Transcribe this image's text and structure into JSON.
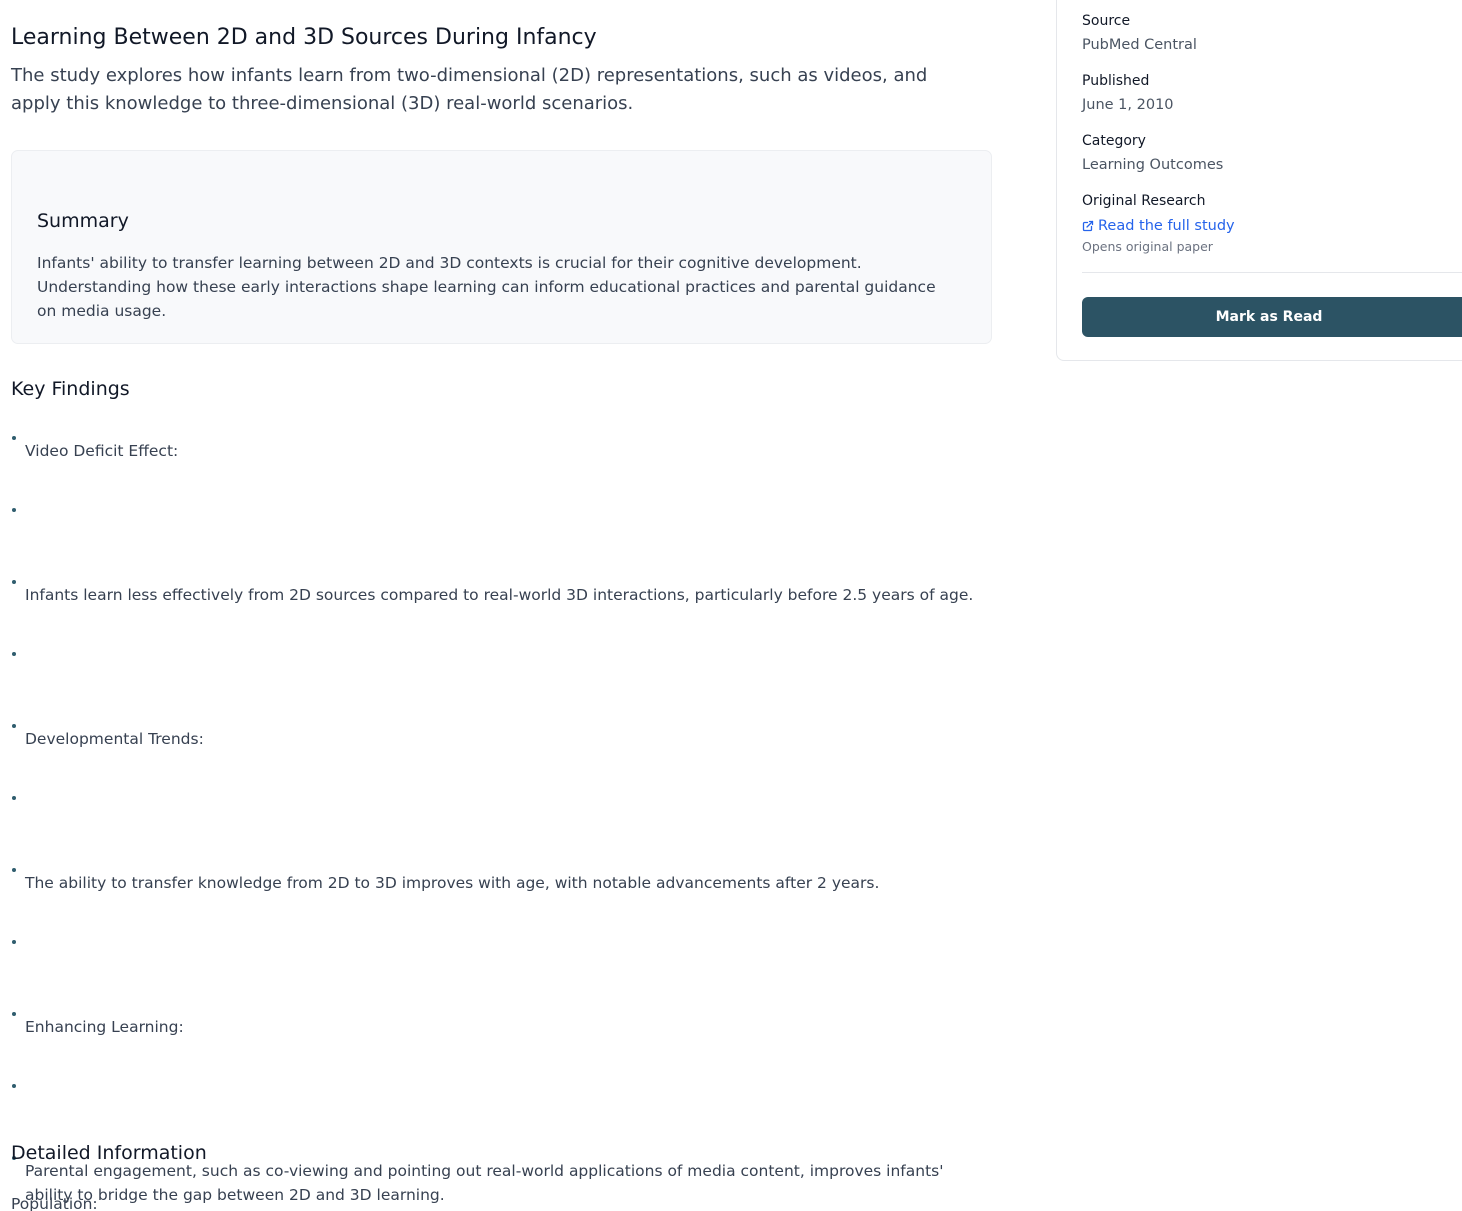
{
  "article": {
    "title": "Learning Between 2D and 3D Sources During Infancy",
    "subtitle": "The study explores how infants learn from two-dimensional (2D) representations, such as videos, and apply this knowledge to three-dimensional (3D) real-world scenarios."
  },
  "summary": {
    "heading": "Summary",
    "text": "Infants' ability to transfer learning between 2D and 3D contexts is crucial for their cognitive development. Understanding how these early interactions shape learning can inform educational practices and parental guidance on media usage."
  },
  "key_findings": {
    "heading": "Key Findings",
    "items": [
      "Video Deficit Effect:",
      "",
      "Infants learn less effectively from 2D sources compared to real-world 3D interactions, particularly before 2.5 years of age.",
      "",
      "Developmental Trends:",
      "",
      "The ability to transfer knowledge from 2D to 3D improves with age, with notable advancements after 2 years.",
      "",
      "Enhancing Learning:",
      "",
      "Parental engagement, such as co-viewing and pointing out real-world applications of media content, improves infants' ability to bridge the gap between 2D and 3D learning."
    ]
  },
  "detailed_information": {
    "heading": "Detailed Information",
    "population_label": "Population:"
  },
  "sidebar": {
    "source_label": "Source",
    "source_value": "PubMed Central",
    "published_label": "Published",
    "published_value": "June 1, 2010",
    "category_label": "Category",
    "category_value": "Learning Outcomes",
    "research_label": "Original Research",
    "link_text": "Read the full study",
    "link_icon": "external-link-icon",
    "link_note": "Opens original paper",
    "mark_read_label": "Mark as Read"
  },
  "colors": {
    "accent": "#2c5364",
    "link": "#2563eb",
    "bullet": "#2f5d6e",
    "card_bg": "#f8f9fb"
  }
}
